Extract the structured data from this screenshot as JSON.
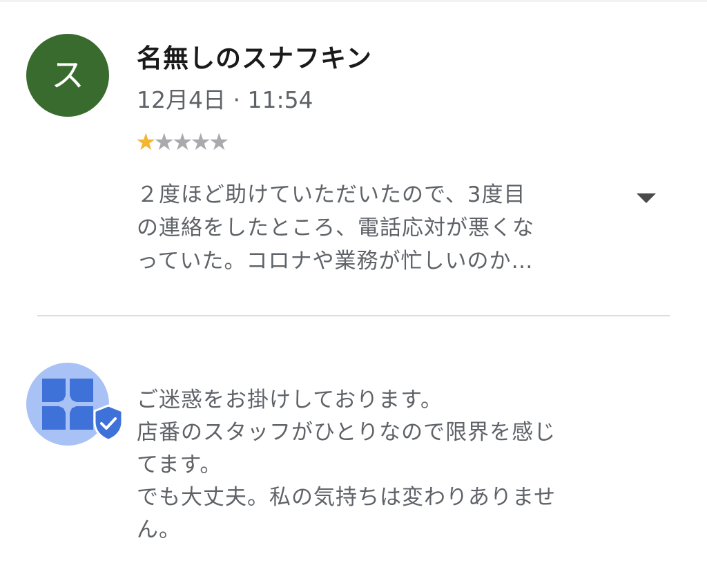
{
  "review": {
    "avatar_initial": "ス",
    "reviewer_name": "名無しのスナフキン",
    "date": "12月4日 · 11:54",
    "rating": 1,
    "rating_max": 5,
    "stars": [
      "★",
      "★",
      "★",
      "★",
      "★"
    ],
    "text_lines": [
      "２度ほど助けていただいたので、3度目",
      "の連絡をしたところ、電話応対が悪くな",
      "っていた。コロナや業務が忙しいのか…"
    ],
    "expand_icon": "chevron-down-icon"
  },
  "owner_reply": {
    "avatar_icon": "store-icon",
    "badge_icon": "verified-shield-icon",
    "text_lines": [
      "ご迷惑をお掛けしております。",
      "店番のスタッフがひとりなので限界を感じ",
      "てます。",
      "でも大丈夫。私の気持ちは変わりありませ",
      "ん。"
    ]
  },
  "colors": {
    "avatar_bg": "#3a6b2e",
    "star_filled": "#f2b632",
    "star_empty": "#a8aaad",
    "owner_avatar_bg": "#a9c2f5",
    "owner_icon": "#3f72d8",
    "text_secondary": "#5f6368"
  }
}
